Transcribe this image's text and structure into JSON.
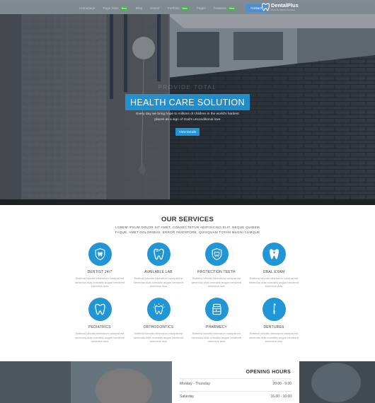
{
  "nav": {
    "items": [
      {
        "label": "Homepage",
        "badge": ""
      },
      {
        "label": "Page Sites",
        "badge": "New"
      },
      {
        "label": "Blog",
        "badge": ""
      },
      {
        "label": "Doctor",
        "badge": ""
      },
      {
        "label": "Portfolio",
        "badge": "New"
      },
      {
        "label": "Pages",
        "badge": ""
      },
      {
        "label": "Features",
        "badge": "New"
      }
    ],
    "cta_label": "Contact"
  },
  "logo": {
    "name": "DentalPlus",
    "tagline": "Premium Dental Template"
  },
  "hero": {
    "subtitle": "PROVIDE TOTAL",
    "title": "HEALTH CARE SOLUTION",
    "description": "Every day we bring hope to millions of children in the world's hardest places as a sign of God's unconditional love",
    "button_label": "View Details"
  },
  "services": {
    "title": "OUR SERVICES",
    "subtitle": "LOREM IPSUM DOLOR SIT AMET, CONSECTETUR ADIPISICING ELIT. NEQUE QUIDEM FAQUE, AMET DOLORIBUS, ERROR INVENTORE, QUISQUAM TOTAM MAGNI CUMQUE",
    "items": [
      {
        "title": "DENTIST 24/7",
        "icon": "tooth-shield-icon",
        "desc": "Eleifend lobortis bibendum volutpat est senectus duis convallis augue hendrerit senectus duis"
      },
      {
        "title": "AVAILABLE LAB",
        "icon": "tooth-icon",
        "desc": "Eleifend lobortis bibendum volutpat est senectus duis convallis augue hendrerit senectus duis"
      },
      {
        "title": "PROTECTION TEETH",
        "icon": "tooth-shield-icon",
        "desc": "Eleifend lobortis bibendum volutpat est senectus duis convallis augue hendrerit senectus duis"
      },
      {
        "title": "ORAL EXAM",
        "icon": "tooth-icon",
        "desc": "Eleifend lobortis bibendum volutpat est senectus duis convallis augue hendrerit senectus duis"
      },
      {
        "title": "PEDIATRICS",
        "icon": "tooth-icon",
        "desc": "Eleifend lobortis bibendum volutpat est senectus duis convallis augue hendrerit senectus duis"
      },
      {
        "title": "ORTHODONTICS",
        "icon": "sparkle-tooth-icon",
        "desc": "Eleifend lobortis bibendum volutpat est senectus duis convallis augue hendrerit senectus duis"
      },
      {
        "title": "PHARMECY",
        "icon": "pill-jar-icon",
        "desc": "Eleifend lobortis bibendum volutpat est senectus duis convallis augue hendrerit senectus duis"
      },
      {
        "title": "DENTURES",
        "icon": "dental-tool-icon",
        "desc": "Eleifend lobortis bibendum volutpat est senectus duis convallis augue hendrerit senectus duis"
      }
    ]
  },
  "hours": {
    "title": "OPENING HOURS",
    "rows": [
      {
        "day": "Monday - Thursday",
        "time": "20.00 - 9.00"
      },
      {
        "day": "Saturday",
        "time": "16.00 - 10.00"
      }
    ]
  },
  "colors": {
    "accent": "#2196d7",
    "badge": "#4caf50",
    "cta": "#4a8fd6"
  }
}
